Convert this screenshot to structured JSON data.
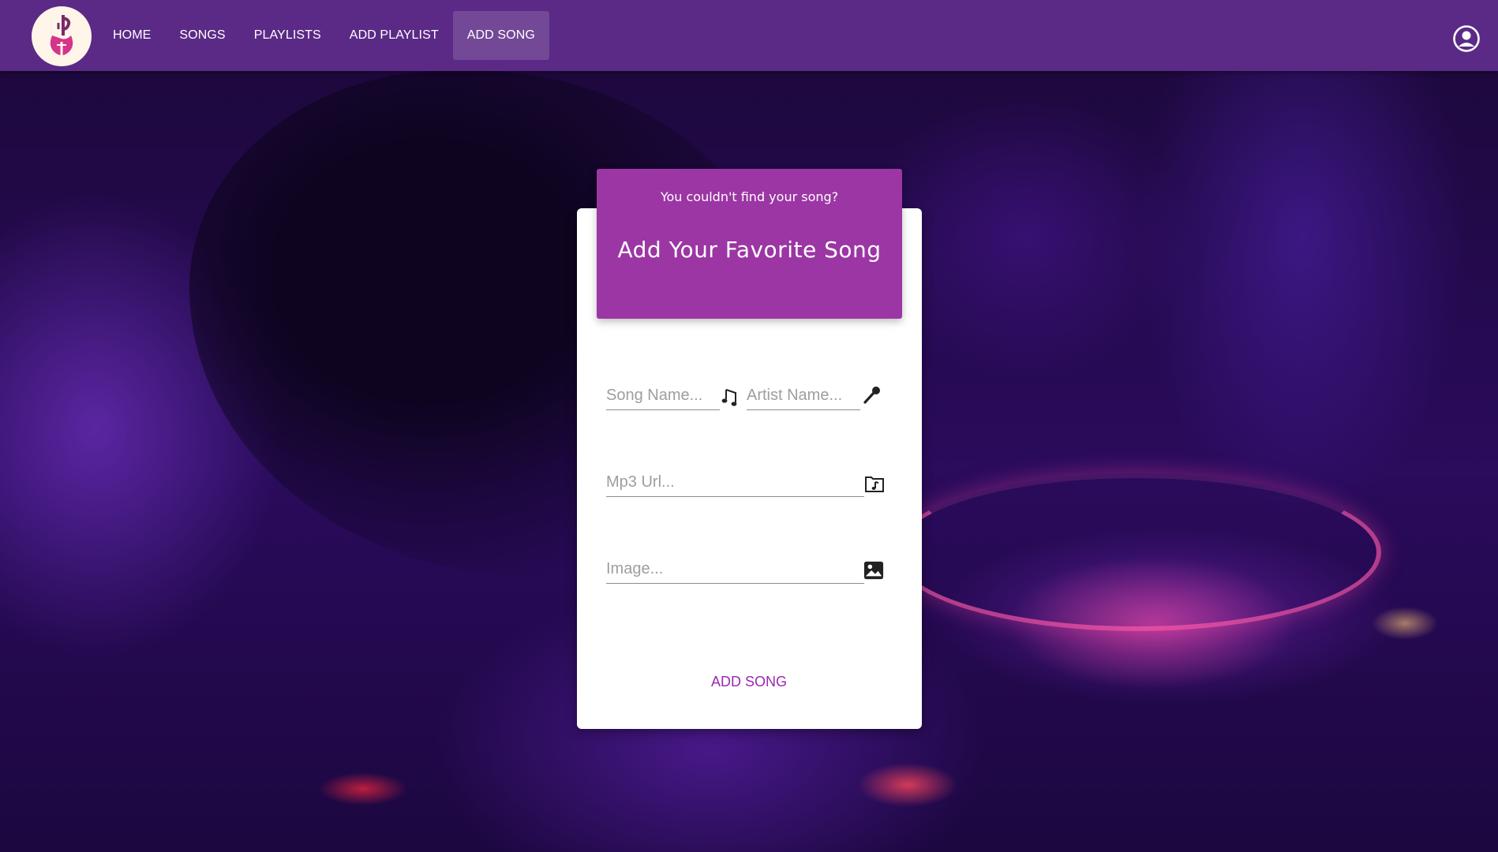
{
  "nav": {
    "links": [
      "HOME",
      "SONGS",
      "PLAYLISTS",
      "ADD PLAYLIST",
      "ADD SONG"
    ],
    "active": "ADD SONG"
  },
  "card": {
    "subtitle": "You couldn't find your song?",
    "title": "Add Your Favorite Song"
  },
  "form": {
    "song_name_placeholder": "Song Name...",
    "artist_name_placeholder": "Artist Name...",
    "mp3_url_placeholder": "Mp3 Url...",
    "image_placeholder": "Image...",
    "submit_label": "ADD SONG"
  },
  "icons": {
    "logo": "guitar-logo-icon",
    "account": "account-circle-icon",
    "song": "music-notes-icon",
    "artist": "microphone-icon",
    "mp3": "music-folder-icon",
    "image": "image-icon"
  },
  "colors": {
    "navbar": "#5b2a86",
    "header": "#9c36a4",
    "accent": "#9c27b0"
  }
}
